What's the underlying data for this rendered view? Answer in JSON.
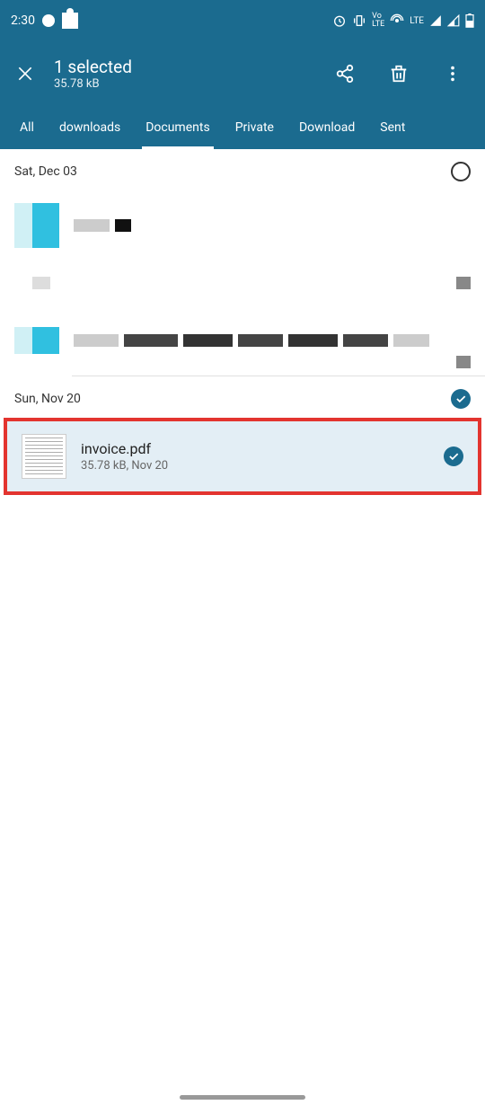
{
  "status": {
    "time": "2:30",
    "network": "LTE"
  },
  "header": {
    "title": "1 selected",
    "subtitle": "35.78 kB"
  },
  "tabs": {
    "all": "All",
    "downloads": "downloads",
    "documents": "Documents",
    "private": "Private",
    "download": "Download",
    "sent": "Sent"
  },
  "groups": {
    "g1": {
      "date": "Sat, Dec 03"
    },
    "g2": {
      "date": "Sun, Nov 20"
    }
  },
  "files": {
    "invoice": {
      "name": "invoice.pdf",
      "meta": "35.78 kB, Nov 20"
    }
  }
}
